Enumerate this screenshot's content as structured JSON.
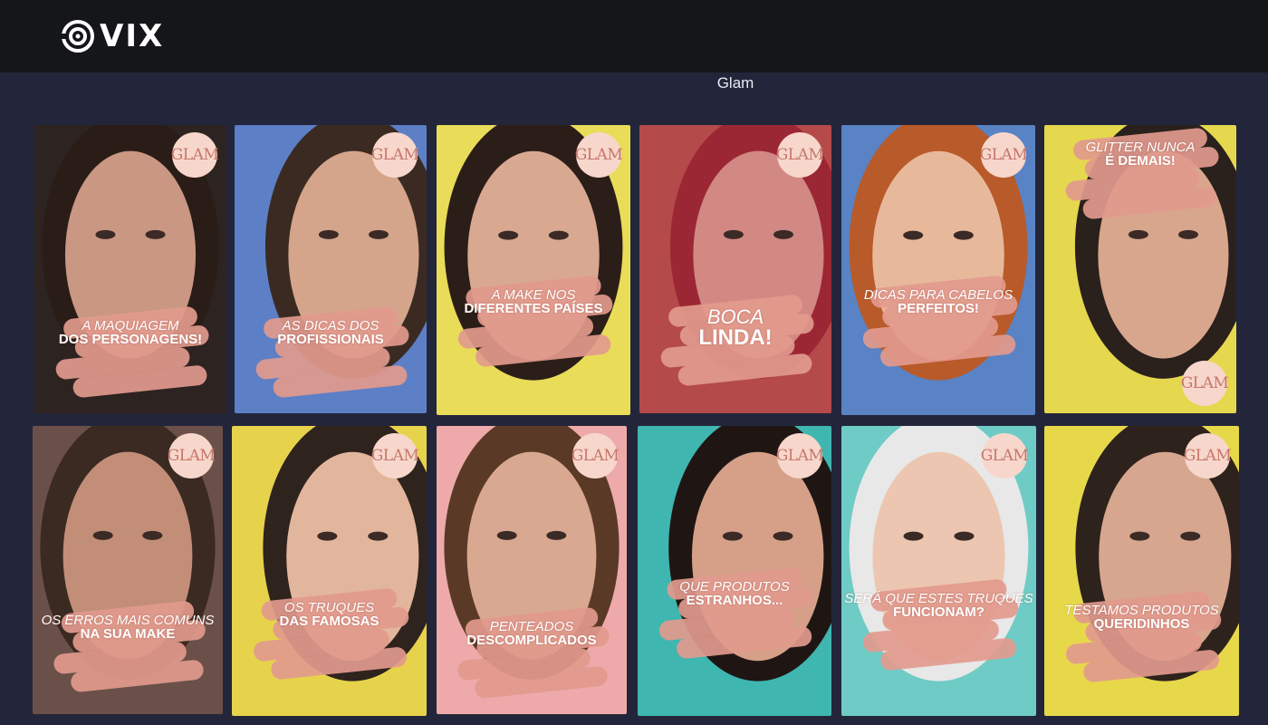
{
  "header": {
    "logo_text": "VIX",
    "logo_icon": "vix-target-icon"
  },
  "section": {
    "title": "Glam"
  },
  "badge_label": "GLAM",
  "colors": {
    "topbar": "#151619",
    "page_bg": "#23263a",
    "badge_bg": "#f7d7cb",
    "badge_text": "#c7766b",
    "brush_stroke": "#e29a8d"
  },
  "cards": [
    {
      "l1": "A MAQUIAGEM",
      "l2": "DOS PERSONAGENS!",
      "bg": "#2d2320"
    },
    {
      "l1": "AS DICAS DOS",
      "l2": "PROFISSIONAIS",
      "bg": "#5d7fc6"
    },
    {
      "l1": "A MAKE NOS",
      "l2": "DIFERENTES PAÍSES",
      "bg": "#e9dc58"
    },
    {
      "l1": "BOCA",
      "l2": "LINDA!",
      "bg": "#b54a4a"
    },
    {
      "l1": "DICAS PARA CABELOS",
      "l2": "PERFEITOS!",
      "bg": "#5983c4"
    },
    {
      "l1": "GLITTER NUNCA",
      "l2": "É DEMAIS!",
      "bg": "#e6d84e"
    },
    {
      "l1": "OS ERROS MAIS COMUNS",
      "l2": "NA SUA MAKE",
      "bg": "#6b5049"
    },
    {
      "l1": "OS TRUQUES",
      "l2": "DAS FAMOSAS",
      "bg": "#e7d34b"
    },
    {
      "l1": "PENTEADOS",
      "l2": "DESCOMPLICADOS",
      "bg": "#eeaaaa"
    },
    {
      "l1": "QUE PRODUTOS",
      "l2": "ESTRANHOS...",
      "bg": "#3fb6b0"
    },
    {
      "l1": "SERÁ QUE ESTES TRUQUES",
      "l2": "FUNCIONAM?",
      "bg": "#6fcbc5"
    },
    {
      "l1": "TESTAMOS PRODUTOS",
      "l2": "QUERIDINHOS",
      "bg": "#e7d84a"
    }
  ]
}
